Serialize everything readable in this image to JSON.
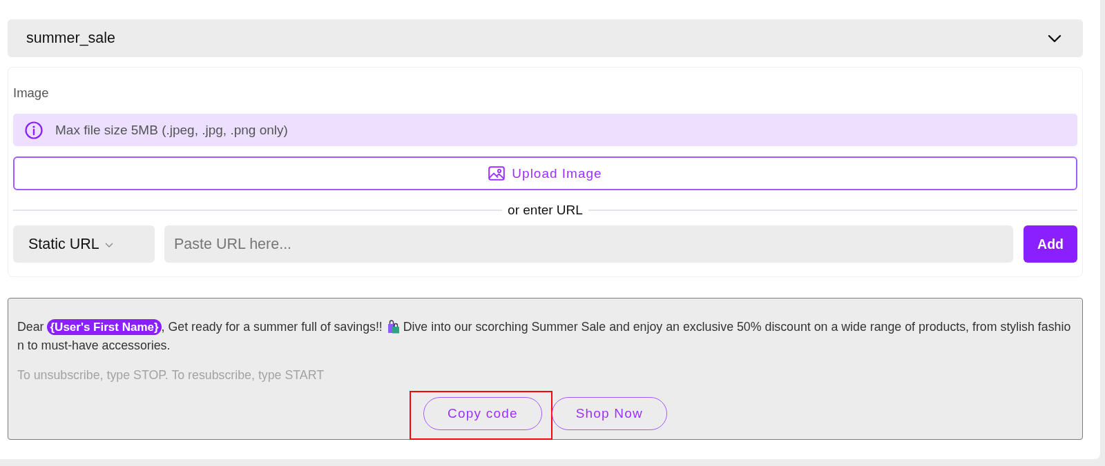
{
  "template_select": {
    "value": "summer_sale"
  },
  "image_section": {
    "label": "Image",
    "info": "Max file size 5MB (.jpeg, .jpg, .png only)",
    "upload_button": "Upload Image",
    "divider": "or enter URL",
    "url_type": {
      "value": "Static URL"
    },
    "url_input": {
      "placeholder": "Paste URL here..."
    },
    "add_button": "Add"
  },
  "message_preview": {
    "body": [
      {
        "kind": "text",
        "text": "Dear "
      },
      {
        "kind": "variable",
        "text": "{User's First Name}"
      },
      {
        "kind": "text",
        "text": ", Get ready for a summer full of savings!! "
      },
      {
        "kind": "emoji"
      },
      {
        "kind": "text",
        "text": " Dive into our scorching Summer Sale and enjoy an exclusive 50% discount on a wide range of products, from stylish fashion to must-have accessories."
      }
    ],
    "footer": "To unsubscribe, type STOP. To resubscribe, type START",
    "buttons": [
      {
        "label": "Copy code",
        "highlighted": true
      },
      {
        "label": "Shop Now",
        "highlighted": false
      }
    ]
  }
}
